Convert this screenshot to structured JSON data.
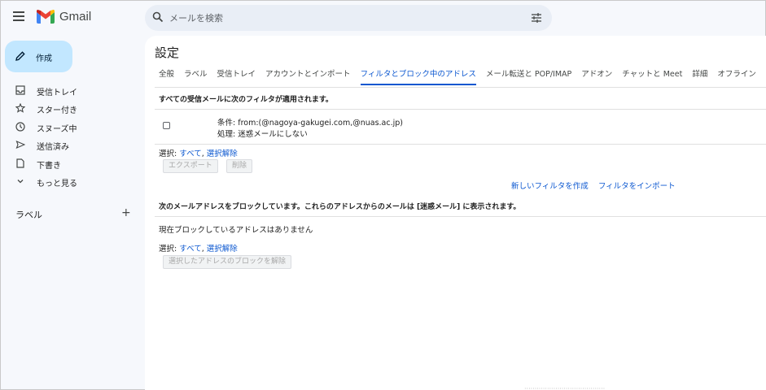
{
  "app": {
    "name": "Gmail"
  },
  "search": {
    "placeholder": "メールを検索"
  },
  "sidebar": {
    "compose_label": "作成",
    "items": [
      {
        "label": "受信トレイ",
        "icon": "inbox-icon"
      },
      {
        "label": "スター付き",
        "icon": "star-icon"
      },
      {
        "label": "スヌーズ中",
        "icon": "clock-icon"
      },
      {
        "label": "送信済み",
        "icon": "send-icon"
      },
      {
        "label": "下書き",
        "icon": "draft-icon"
      },
      {
        "label": "もっと見る",
        "icon": "chevron-down-icon"
      }
    ],
    "labels_title": "ラベル",
    "labels_add": "+"
  },
  "settings": {
    "title": "設定",
    "tabs": [
      {
        "label": "全般"
      },
      {
        "label": "ラベル"
      },
      {
        "label": "受信トレイ"
      },
      {
        "label": "アカウントとインポート"
      },
      {
        "label": "フィルタとブロック中のアドレス",
        "active": true
      },
      {
        "label": "メール転送と POP/IMAP"
      },
      {
        "label": "アドオン"
      },
      {
        "label": "チャットと Meet"
      },
      {
        "label": "詳細"
      },
      {
        "label": "オフライン"
      }
    ],
    "filters": {
      "heading": "すべての受信メールに次のフィルタが適用されます。",
      "condition": "条件: from:(@nagoya-gakugei.com,@nuas.ac.jp)",
      "action": "処理: 迷惑メールにしない",
      "select_prefix": "選択: ",
      "select_all": "すべて",
      "select_sep": ", ",
      "select_none": "選択解除",
      "export_button": "エクスポート",
      "delete_button": "削除",
      "create_link": "新しいフィルタを作成",
      "import_link": "フィルタをインポート"
    },
    "blocked": {
      "heading": "次のメールアドレスをブロックしています。これらのアドレスからのメールは [迷惑メール] に表示されます。",
      "empty": "現在ブロックしているアドレスはありません",
      "select_prefix": "選択: ",
      "select_all": "すべて",
      "select_sep": ", ",
      "select_none": "選択解除",
      "unblock_button": "選択したアドレスのブロックを解除"
    }
  },
  "colors": {
    "accent": "#0b57d0",
    "compose_bg": "#c2e7ff",
    "background": "#f6f8fc"
  }
}
